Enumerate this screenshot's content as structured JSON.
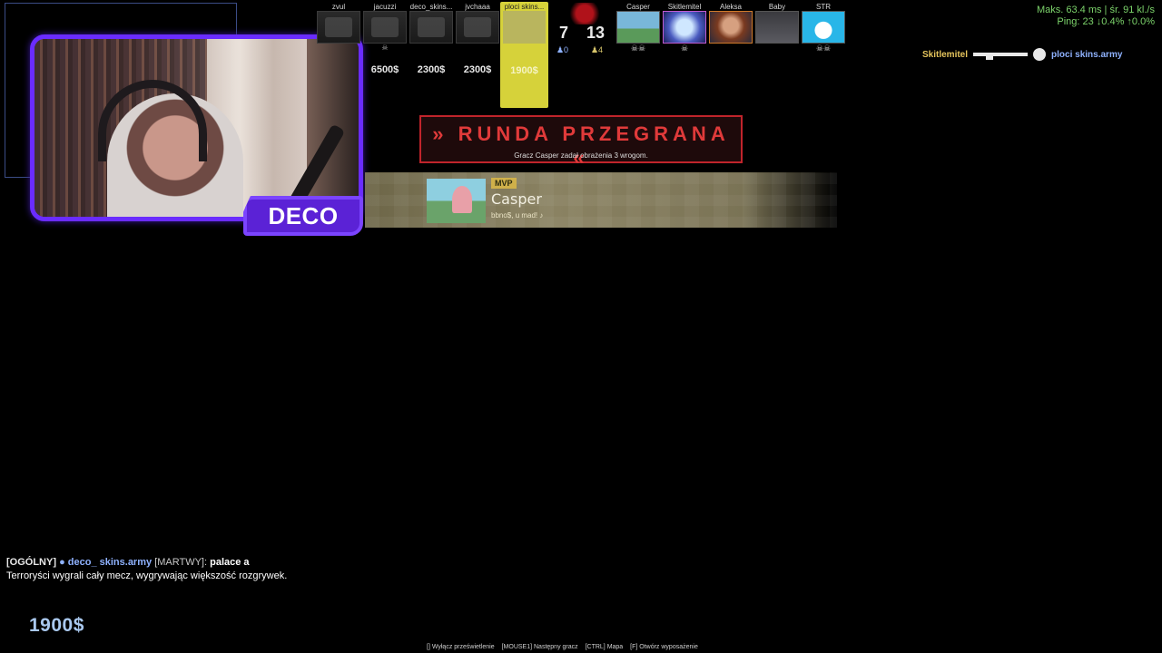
{
  "webcam": {
    "tag_label": "DECO"
  },
  "scoreboard": {
    "t_players": [
      {
        "name": "zvul",
        "money": ""
      },
      {
        "name": "jacuzzi",
        "money": "6500$"
      },
      {
        "name": "deco_skins...",
        "money": "2300$"
      },
      {
        "name": "jvchaaa",
        "money": "2300$"
      }
    ],
    "selected_player": {
      "name": "ploci skins...",
      "money": "1900$"
    },
    "t_score": "7",
    "ct_score": "13",
    "t_alive": "0",
    "ct_alive": "4",
    "ct_players": [
      {
        "name": "Casper",
        "skulls": "☠☠"
      },
      {
        "name": "Skitlemitel",
        "skulls": "☠"
      },
      {
        "name": "Aleksa",
        "skulls": ""
      },
      {
        "name": "Baby",
        "skulls": ""
      },
      {
        "name": "STR",
        "skulls": "☠☠"
      }
    ],
    "dead_marker": "☠"
  },
  "round_banner": {
    "title": "» RUNDA PRZEGRANA «",
    "subtitle": "Gracz Casper zadał obrażenia 3 wrogom."
  },
  "mvp": {
    "badge": "MVP",
    "name": "Casper",
    "music": "bbno$, u mad! ♪"
  },
  "netgraph": {
    "line1": "Maks.  63.4 ms | śr.  91 kl./s",
    "line2": "Ping:  23   ↓0.4%   ↑0.0%"
  },
  "killfeed": {
    "killer": "Skitlemitel",
    "victim": "ploci skins.army"
  },
  "chat": {
    "tag": "[OGÓLNY]",
    "bullet": "●",
    "name": "deco_ skins.army",
    "status": "[MARTWY]:",
    "message": "palace a",
    "system_line": "Terroryści wygrali cały mecz, wygrywając większość rozgrywek."
  },
  "hud": {
    "money": "1900$"
  },
  "hints": [
    "[] Wyłącz prześwietlenie",
    "[MOUSE1] Następny gracz",
    "[CTRL] Mapa",
    "[F] Otwórz wyposażenie"
  ],
  "colors": {
    "accent_purple": "#6a2cff",
    "t_side": "#d6d23a",
    "loss_red": "#e03a3a",
    "netgraph_green": "#7cd36b",
    "ct_name_blue": "#8fb2ff"
  }
}
